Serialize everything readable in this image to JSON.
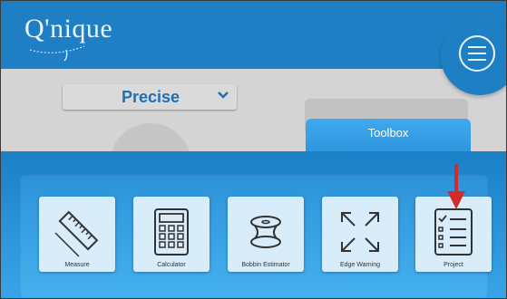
{
  "app": {
    "logo_text": "Q'nique"
  },
  "header": {
    "menu_icon": "hamburger-menu-icon"
  },
  "mode_select": {
    "value": "Precise",
    "icon": "chevron-down-icon"
  },
  "toolbox": {
    "tab_label": "Toolbox",
    "tools": [
      {
        "label": "Measure",
        "icon": "ruler-icon"
      },
      {
        "label": "Calculator",
        "icon": "calculator-icon"
      },
      {
        "label": "Bobbin Estimator",
        "icon": "bobbin-icon"
      },
      {
        "label": "Edge Warning",
        "icon": "expand-arrows-icon"
      },
      {
        "label": "Project",
        "icon": "checklist-icon"
      }
    ]
  },
  "annotation": {
    "icon": "red-arrow-down-icon",
    "color": "#d22b2b"
  },
  "colors": {
    "primary": "#1f7fc4",
    "tile": "#d8ecfa",
    "accent_text": "#1e6fb5"
  }
}
